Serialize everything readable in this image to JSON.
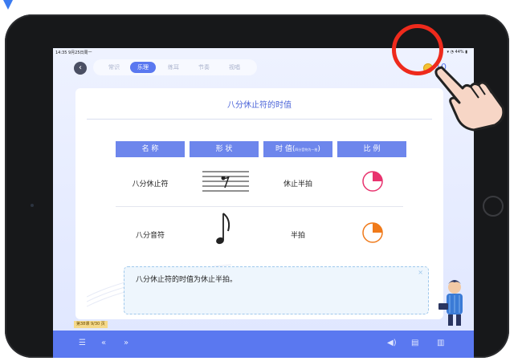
{
  "status": {
    "time": "14:35  9月25日周一",
    "battery": "44%"
  },
  "tabs": [
    {
      "label": "常识",
      "active": false
    },
    {
      "label": "乐理",
      "active": true
    },
    {
      "label": "练耳",
      "active": false
    },
    {
      "label": "节奏",
      "active": false
    },
    {
      "label": "视唱",
      "active": false
    }
  ],
  "coins": "10",
  "card": {
    "title": "八分休止符的时值",
    "headers": [
      "名 称",
      "形 状",
      "时 值(",
      "比 例"
    ],
    "header_sub": "四分音符为一拍",
    "rows": [
      {
        "name": "八分休止符",
        "duration": "休止半拍"
      },
      {
        "name": "八分音符",
        "duration": "半拍"
      }
    ]
  },
  "note": {
    "text": "八分休止符的时值为休止半拍。",
    "close": "×"
  },
  "page_tag": "第38课  9/30 页",
  "colors": {
    "accent": "#5a78f0",
    "highlight_circle": "#ee2a1c",
    "pie_rest": "#e8336e",
    "pie_note": "#f07a1a"
  },
  "icons": [
    "menu-icon",
    "prev-page-icon",
    "next-page-icon",
    "speaker-icon",
    "print-icon",
    "keyboard-icon"
  ]
}
